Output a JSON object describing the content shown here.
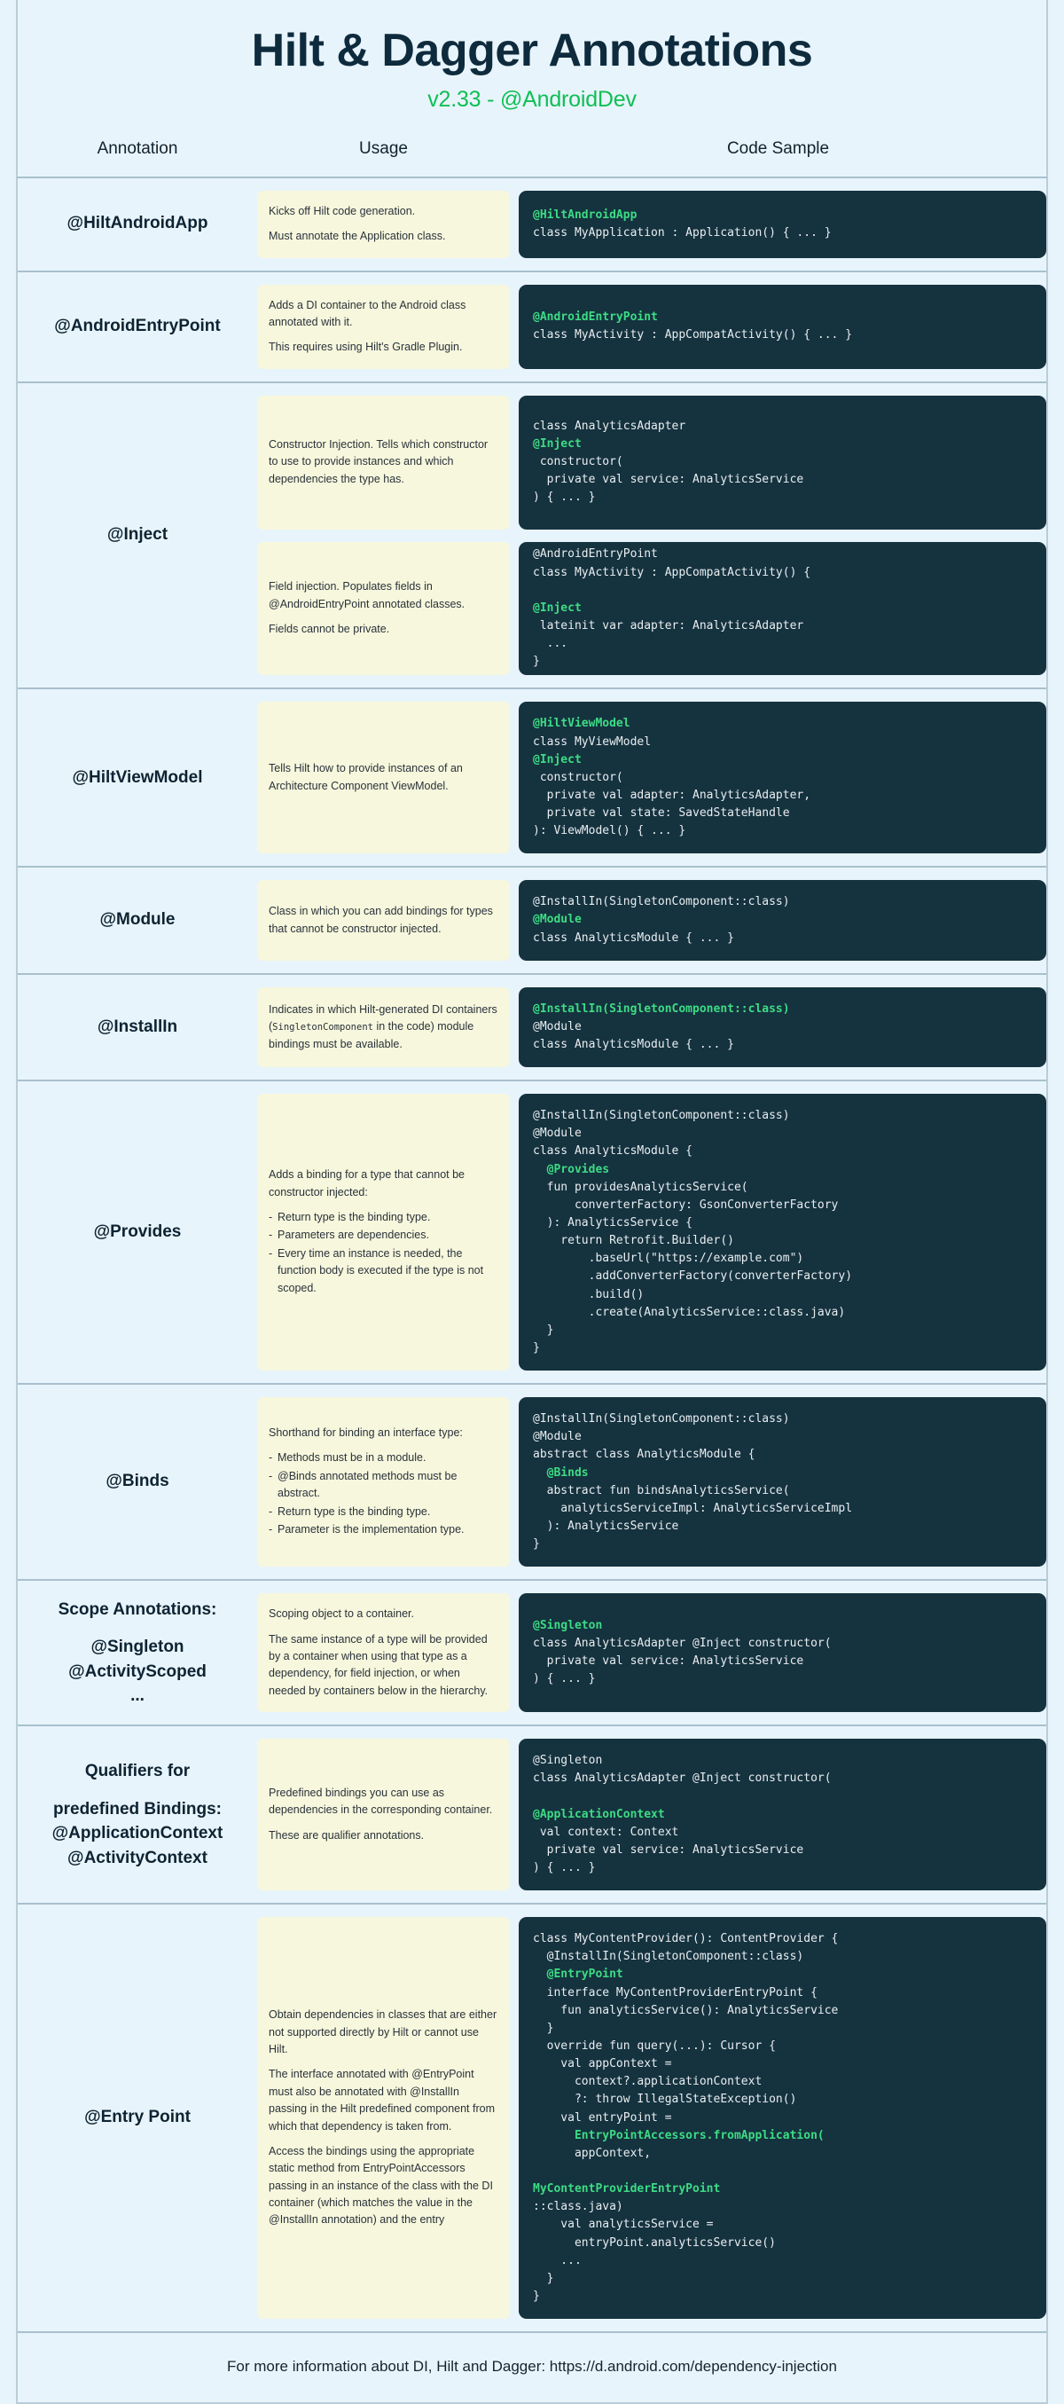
{
  "header": {
    "title": "Hilt & Dagger Annotations",
    "subtitle": "v2.33 - @AndroidDev",
    "accent_green": "#0fbf54",
    "title_color": "#0e2b3d",
    "page_background": "#e8f4fb",
    "usage_box_color": "#f7f7dd",
    "code_box_color": "#15323f",
    "code_highlight_color": "#3ddc84"
  },
  "columns": {
    "annotation": "Annotation",
    "usage": "Usage",
    "code_sample": "Code Sample"
  },
  "rows": [
    {
      "annotation": "@HiltAndroidApp",
      "blocks": [
        {
          "usage_paragraphs": [
            "Kicks off Hilt code generation.",
            "Must annotate the Application class."
          ],
          "usage_bullets": [],
          "code_lines": [
            {
              "t": "@HiltAndroidApp",
              "hl": true
            },
            {
              "t": "class MyApplication : Application() { ... }",
              "hl": false
            }
          ]
        }
      ]
    },
    {
      "annotation": "@AndroidEntryPoint",
      "blocks": [
        {
          "usage_paragraphs": [
            "Adds a DI container to the Android class annotated with it.",
            "This requires using Hilt's Gradle Plugin."
          ],
          "usage_bullets": [],
          "code_lines": [
            {
              "t": "@AndroidEntryPoint",
              "hl": true
            },
            {
              "t": "class MyActivity : AppCompatActivity() { ... }",
              "hl": false
            }
          ]
        }
      ]
    },
    {
      "annotation": "@Inject",
      "blocks": [
        {
          "usage_paragraphs": [
            "Constructor Injection. Tells which constructor to use to provide instances and which dependencies the type has."
          ],
          "usage_bullets": [],
          "code_lines": [
            {
              "t": "class AnalyticsAdapter ",
              "hl": false,
              "seg": [
                {
                  "t": "class AnalyticsAdapter ",
                  "hl": false
                },
                {
                  "t": "@Inject",
                  "hl": true
                },
                {
                  "t": " constructor(",
                  "hl": false
                }
              ]
            },
            {
              "t": "  private val service: AnalyticsService",
              "hl": false
            },
            {
              "t": ") { ... }",
              "hl": false
            }
          ]
        },
        {
          "usage_paragraphs": [
            "Field injection. Populates fields in @AndroidEntryPoint annotated classes.",
            "Fields cannot be private."
          ],
          "usage_bullets": [],
          "code_lines": [
            {
              "t": "@AndroidEntryPoint",
              "hl": false
            },
            {
              "t": "class MyActivity : AppCompatActivity() {",
              "hl": false
            },
            {
              "t": "",
              "hl": false,
              "seg": [
                {
                  "t": "  ",
                  "hl": false
                },
                {
                  "t": "@Inject",
                  "hl": true
                },
                {
                  "t": " lateinit var adapter: AnalyticsAdapter",
                  "hl": false
                }
              ]
            },
            {
              "t": "  ...",
              "hl": false
            },
            {
              "t": "}",
              "hl": false
            }
          ]
        }
      ]
    },
    {
      "annotation": "@HiltViewModel",
      "blocks": [
        {
          "usage_paragraphs": [
            "Tells Hilt how to provide instances of an Architecture Component ViewModel."
          ],
          "usage_bullets": [],
          "code_lines": [
            {
              "t": "@HiltViewModel",
              "hl": true
            },
            {
              "t": "",
              "hl": false,
              "seg": [
                {
                  "t": "class MyViewModel ",
                  "hl": false
                },
                {
                  "t": "@Inject",
                  "hl": true
                },
                {
                  "t": " constructor(",
                  "hl": false
                }
              ]
            },
            {
              "t": "  private val adapter: AnalyticsAdapter,",
              "hl": false
            },
            {
              "t": "  private val state: SavedStateHandle",
              "hl": false
            },
            {
              "t": "): ViewModel() { ... }",
              "hl": false
            }
          ]
        }
      ]
    },
    {
      "annotation": "@Module",
      "blocks": [
        {
          "usage_paragraphs": [
            "Class in which you can add bindings for types that cannot be constructor injected."
          ],
          "usage_bullets": [],
          "code_lines": [
            {
              "t": "@InstallIn(SingletonComponent::class)",
              "hl": false
            },
            {
              "t": "@Module",
              "hl": true
            },
            {
              "t": "class AnalyticsModule { ... }",
              "hl": false
            }
          ]
        }
      ]
    },
    {
      "annotation": "@InstallIn",
      "blocks": [
        {
          "usage_paragraphs": [
            "Indicates in which Hilt-generated DI containers (SingletonComponent in the code) module bindings must be available."
          ],
          "usage_code_term": "SingletonComponent",
          "usage_bullets": [],
          "code_lines": [
            {
              "t": "@InstallIn(SingletonComponent::class)",
              "hl": true
            },
            {
              "t": "@Module",
              "hl": false
            },
            {
              "t": "class AnalyticsModule { ... }",
              "hl": false
            }
          ]
        }
      ]
    },
    {
      "annotation": "@Provides",
      "blocks": [
        {
          "usage_paragraphs": [
            "Adds a binding for a type that cannot be constructor injected:"
          ],
          "usage_bullets": [
            "Return type is the binding type.",
            "Parameters are dependencies.",
            "Every time an instance is needed, the function body is executed if the type is not scoped."
          ],
          "code_lines": [
            {
              "t": "@InstallIn(SingletonComponent::class)",
              "hl": false
            },
            {
              "t": "@Module",
              "hl": false
            },
            {
              "t": "class AnalyticsModule {",
              "hl": false
            },
            {
              "t": "",
              "hl": false
            },
            {
              "t": "  @Provides",
              "hl": true
            },
            {
              "t": "  fun providesAnalyticsService(",
              "hl": false
            },
            {
              "t": "      converterFactory: GsonConverterFactory",
              "hl": false
            },
            {
              "t": "  ): AnalyticsService {",
              "hl": false
            },
            {
              "t": "    return Retrofit.Builder()",
              "hl": false
            },
            {
              "t": "        .baseUrl(\"https://example.com\")",
              "hl": false
            },
            {
              "t": "        .addConverterFactory(converterFactory)",
              "hl": false
            },
            {
              "t": "        .build()",
              "hl": false
            },
            {
              "t": "        .create(AnalyticsService::class.java)",
              "hl": false
            },
            {
              "t": "  }",
              "hl": false
            },
            {
              "t": "}",
              "hl": false
            }
          ]
        }
      ]
    },
    {
      "annotation": "@Binds",
      "blocks": [
        {
          "usage_paragraphs": [
            "Shorthand for binding an interface type:"
          ],
          "usage_bullets": [
            "Methods must be in a module.",
            "@Binds annotated methods must be abstract.",
            "Return type is the binding type.",
            "Parameter is the implementation type."
          ],
          "code_lines": [
            {
              "t": "@InstallIn(SingletonComponent::class)",
              "hl": false
            },
            {
              "t": "@Module",
              "hl": false
            },
            {
              "t": "abstract class AnalyticsModule {",
              "hl": false
            },
            {
              "t": "",
              "hl": false
            },
            {
              "t": "  @Binds",
              "hl": true
            },
            {
              "t": "  abstract fun bindsAnalyticsService(",
              "hl": false
            },
            {
              "t": "    analyticsServiceImpl: AnalyticsServiceImpl",
              "hl": false
            },
            {
              "t": "  ): AnalyticsService",
              "hl": false
            },
            {
              "t": "}",
              "hl": false
            }
          ]
        }
      ]
    },
    {
      "annotation": "Scope Annotations:",
      "annotation_extra": [
        "@Singleton",
        "@ActivityScoped",
        "..."
      ],
      "blocks": [
        {
          "usage_paragraphs": [
            "Scoping object to a container.",
            "The same instance of a type will be provided by a container when using that type as a dependency, for field injection, or when needed by containers below in the hierarchy."
          ],
          "usage_bullets": [],
          "code_lines": [
            {
              "t": "@Singleton",
              "hl": true
            },
            {
              "t": "class AnalyticsAdapter @Inject constructor(",
              "hl": false
            },
            {
              "t": "  private val service: AnalyticsService",
              "hl": false
            },
            {
              "t": ") { ... }",
              "hl": false
            }
          ]
        }
      ]
    },
    {
      "annotation": "Qualifiers for",
      "annotation_extra": [
        "predefined Bindings:",
        "@ApplicationContext",
        "@ActivityContext"
      ],
      "blocks": [
        {
          "usage_paragraphs": [
            "Predefined bindings you can use as dependencies in the corresponding container.",
            "These are qualifier annotations."
          ],
          "usage_bullets": [],
          "code_lines": [
            {
              "t": "@Singleton",
              "hl": false
            },
            {
              "t": "class AnalyticsAdapter @Inject constructor(",
              "hl": false
            },
            {
              "t": "",
              "hl": false,
              "seg": [
                {
                  "t": "  ",
                  "hl": false
                },
                {
                  "t": "@ApplicationContext",
                  "hl": true
                },
                {
                  "t": " val context: Context",
                  "hl": false
                }
              ]
            },
            {
              "t": "  private val service: AnalyticsService",
              "hl": false
            },
            {
              "t": ") { ... }",
              "hl": false
            }
          ]
        }
      ]
    },
    {
      "annotation": "@Entry Point",
      "blocks": [
        {
          "usage_paragraphs": [
            "Obtain dependencies in classes that are either not supported directly by Hilt or cannot use Hilt.",
            "The interface annotated with @EntryPoint must also be annotated with @InstallIn passing in the Hilt predefined component from which that dependency is taken from.",
            "Access the bindings using the appropriate static method from EntryPointAccessors passing in an instance of the class with the DI container (which matches the value in the @InstallIn annotation) and the entry"
          ],
          "usage_bullets": [],
          "code_lines": [
            {
              "t": "class MyContentProvider(): ContentProvider {",
              "hl": false
            },
            {
              "t": "",
              "hl": false
            },
            {
              "t": "  @InstallIn(SingletonComponent::class)",
              "hl": false
            },
            {
              "t": "  @EntryPoint",
              "hl": true
            },
            {
              "t": "  interface MyContentProviderEntryPoint {",
              "hl": false
            },
            {
              "t": "    fun analyticsService(): AnalyticsService",
              "hl": false
            },
            {
              "t": "  }",
              "hl": false
            },
            {
              "t": "",
              "hl": false
            },
            {
              "t": "  override fun query(...): Cursor {",
              "hl": false
            },
            {
              "t": "    val appContext =",
              "hl": false
            },
            {
              "t": "      context?.applicationContext",
              "hl": false
            },
            {
              "t": "      ?: throw IllegalStateException()",
              "hl": false
            },
            {
              "t": "    val entryPoint =",
              "hl": false
            },
            {
              "t": "      EntryPointAccessors.fromApplication(",
              "hl": true
            },
            {
              "t": "      appContext,",
              "hl": false
            },
            {
              "t": "",
              "hl": false,
              "seg": [
                {
                  "t": "      ",
                  "hl": false
                },
                {
                  "t": "MyContentProviderEntryPoint",
                  "hl": true
                },
                {
                  "t": "::class.java)",
                  "hl": false
                }
              ]
            },
            {
              "t": "    val analyticsService =",
              "hl": false
            },
            {
              "t": "      entryPoint.analyticsService()",
              "hl": false
            },
            {
              "t": "    ...",
              "hl": false
            },
            {
              "t": "  }",
              "hl": false
            },
            {
              "t": "}",
              "hl": false
            }
          ]
        }
      ]
    }
  ],
  "footer": {
    "text": "For more information about DI, Hilt and Dagger: https://d.android.com/dependency-injection"
  }
}
